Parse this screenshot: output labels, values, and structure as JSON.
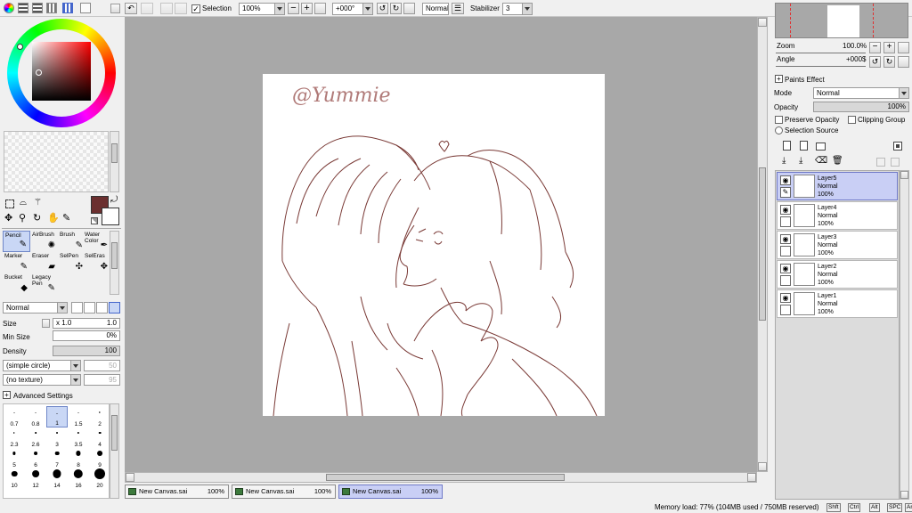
{
  "toolbar": {
    "selection_label": "Selection",
    "zoom_value": "100%",
    "angle_value": "+000°",
    "blend_value": "Normal",
    "stabilizer_label": "Stabilizer",
    "stabilizer_value": "3"
  },
  "color": {
    "primary": "#6b2f2f",
    "secondary": "#ffffff"
  },
  "tools": [
    {
      "label": "Pencil",
      "icon": "pencil-icon"
    },
    {
      "label": "AirBrush",
      "icon": "airbrush-icon"
    },
    {
      "label": "Brush",
      "icon": "brush-icon"
    },
    {
      "label": "Water Color",
      "icon": "watercolor-icon"
    },
    {
      "label": "Marker",
      "icon": "marker-icon"
    },
    {
      "label": "Eraser",
      "icon": "eraser-icon"
    },
    {
      "label": "SelPen",
      "icon": "selpen-icon"
    },
    {
      "label": "SelEras",
      "icon": "seleras-icon"
    },
    {
      "label": "Bucket",
      "icon": "bucket-icon"
    },
    {
      "label": "Legacy Pen",
      "icon": "legacy-pen-icon"
    }
  ],
  "brush": {
    "mode_value": "Normal",
    "size_label": "Size",
    "size_mult": "x 1.0",
    "size_value": "1.0",
    "min_size_label": "Min Size",
    "min_size_value": "0%",
    "density_label": "Density",
    "density_value": "100",
    "shape_value": "(simple circle)",
    "shape_num": "50",
    "texture_value": "(no texture)",
    "texture_num": "95",
    "advanced_label": "Advanced Settings",
    "sizes": [
      "0.7",
      "0.8",
      "1",
      "1.5",
      "2",
      "2.3",
      "2.6",
      "3",
      "3.5",
      "4",
      "5",
      "6",
      "7",
      "8",
      "9",
      "10",
      "12",
      "14",
      "16",
      "20"
    ]
  },
  "canvas": {
    "watermark": "@Yummie"
  },
  "navigator": {
    "zoom_label": "Zoom",
    "zoom_value": "100.0%",
    "angle_label": "Angle",
    "angle_value": "+000$"
  },
  "layer_panel": {
    "paints_effect_label": "Paints Effect",
    "mode_label": "Mode",
    "mode_value": "Normal",
    "opacity_label": "Opacity",
    "opacity_value": "100%",
    "preserve_opacity_label": "Preserve Opacity",
    "clipping_group_label": "Clipping Group",
    "selection_source_label": "Selection Source",
    "layers": [
      {
        "name": "Layer5",
        "mode": "Normal",
        "opacity": "100%"
      },
      {
        "name": "Layer4",
        "mode": "Normal",
        "opacity": "100%"
      },
      {
        "name": "Layer3",
        "mode": "Normal",
        "opacity": "100%"
      },
      {
        "name": "Layer2",
        "mode": "Normal",
        "opacity": "100%"
      },
      {
        "name": "Layer1",
        "mode": "Normal",
        "opacity": "100%"
      }
    ]
  },
  "tabs": [
    {
      "name": "New Canvas.sai",
      "pct": "100%"
    },
    {
      "name": "New Canvas.sai",
      "pct": "100%"
    },
    {
      "name": "New Canvas.sai",
      "pct": "100%"
    }
  ],
  "status": {
    "memory": "Memory load: 77% (104MB used / 750MB reserved)",
    "keys": [
      "Shft",
      "Ctrl",
      "Alt",
      "SPC",
      "Any"
    ]
  }
}
